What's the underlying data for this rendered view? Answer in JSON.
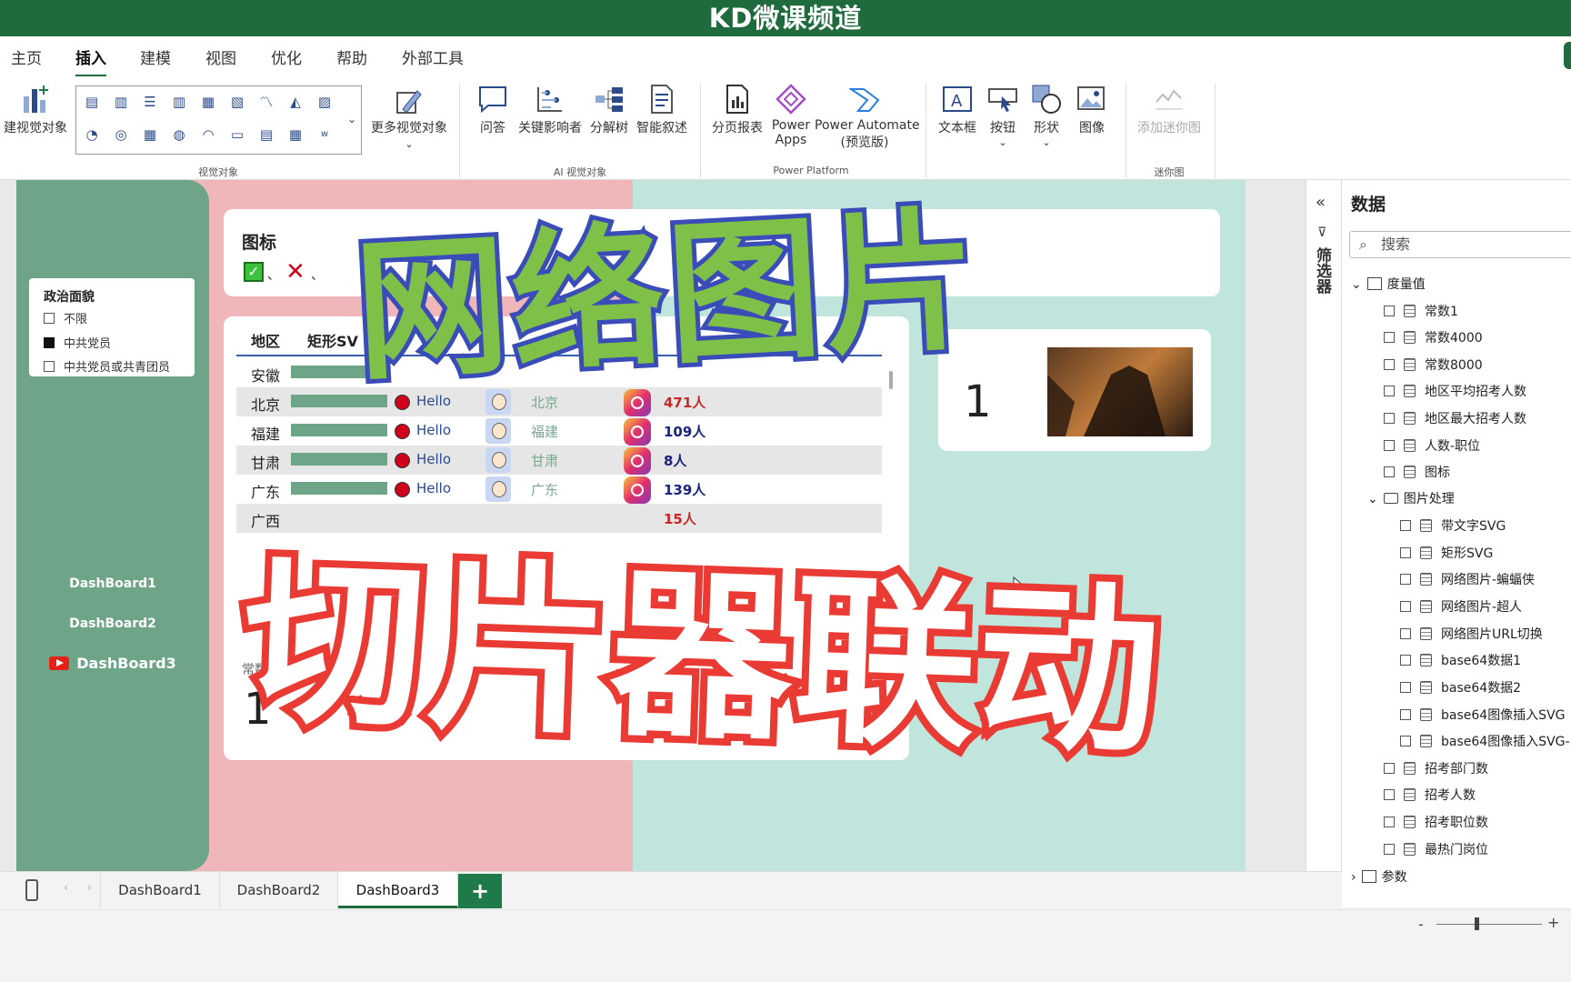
{
  "window": {
    "title": "KD微课频道"
  },
  "menu": {
    "tabs": [
      "主页",
      "插入",
      "建模",
      "视图",
      "优化",
      "帮助",
      "外部工具"
    ],
    "active": "插入"
  },
  "ribbon": {
    "new_visual": "建视觉对象",
    "more_visuals": "更多视觉对象",
    "group_visuals": "视觉对象",
    "qa": "问答",
    "key_influencers": "关键影响者",
    "decomp_tree": "分解树",
    "smart_narrative": "智能叙述",
    "group_ai": "AI 视觉对象",
    "paginated": "分页报表",
    "power_apps_1": "Power",
    "power_apps_2": "Apps",
    "power_automate_1": "Power Automate",
    "power_automate_2": "(预览版)",
    "group_platform": "Power Platform",
    "textbox": "文本框",
    "button": "按钮",
    "shape": "形状",
    "image": "图像",
    "sparkline": "添加迷你图",
    "group_sparkline": "迷你图"
  },
  "slicer": {
    "title": "政治面貌",
    "items": [
      {
        "label": "不限",
        "checked": false
      },
      {
        "label": "中共党员",
        "checked": true
      },
      {
        "label": "中共党员或共青团员",
        "checked": false
      }
    ]
  },
  "nav": {
    "btn1": "DashBoard1",
    "btn2": "DashBoard2",
    "btn3": "DashBoard3"
  },
  "icon_card": {
    "title": "图标",
    "sep1": "、",
    "sep2": "、"
  },
  "table": {
    "headers": {
      "region": "地区",
      "rect": "矩形SV"
    },
    "rows": [
      {
        "region": "安徽",
        "hello": "",
        "city": "",
        "count": "",
        "bar": 0.9,
        "count_color": "#1a237e"
      },
      {
        "region": "北京",
        "hello": "Hello",
        "city": "北京",
        "count": "471人",
        "bar": 0.9,
        "count_color": "#c62828"
      },
      {
        "region": "福建",
        "hello": "Hello",
        "city": "福建",
        "count": "109人",
        "bar": 0.9,
        "count_color": "#1a237e"
      },
      {
        "region": "甘肃",
        "hello": "Hello",
        "city": "甘肃",
        "count": "8人",
        "bar": 0.9,
        "count_color": "#1a237e"
      },
      {
        "region": "广东",
        "hello": "Hello",
        "city": "广东",
        "count": "139人",
        "bar": 0.9,
        "count_color": "#1a237e"
      },
      {
        "region": "广西",
        "hello": "",
        "city": "",
        "count": "15人",
        "bar": 0,
        "count_color": "#c62828"
      }
    ]
  },
  "const_card": {
    "label": "常数1",
    "value": "1"
  },
  "image_card": {
    "value": "1"
  },
  "overlay": {
    "line1": "网络图片",
    "line2": "切片器联动"
  },
  "filters_label": "筛选器",
  "data_pane": {
    "title": "数据",
    "search_placeholder": "搜索",
    "measures_folder": "度量值",
    "measures": [
      "常数1",
      "常数4000",
      "常数8000",
      "地区平均招考人数",
      "地区最大招考人数",
      "人数-职位",
      "图标"
    ],
    "image_folder": "图片处理",
    "image_measures": [
      "带文字SVG",
      "矩形SVG",
      "网络图片-蝙蝠侠",
      "网络图片-超人",
      "网络图片URL切换",
      "base64数据1",
      "base64数据2",
      "base64图像插入SVG",
      "base64图像插入SVG-"
    ],
    "more_measures": [
      "招考部门数",
      "招考人数",
      "招考职位数",
      "最热门岗位"
    ],
    "params": "参数"
  },
  "page_tabs": [
    "DashBoard1",
    "DashBoard2",
    "DashBoard3"
  ],
  "active_page": "DashBoard3",
  "add_tab": "+",
  "colors": {
    "accent": "#1f6b3e",
    "nav_green": "#6ea588",
    "pink": "#f0b7ba",
    "mint": "#bfe5dc"
  }
}
